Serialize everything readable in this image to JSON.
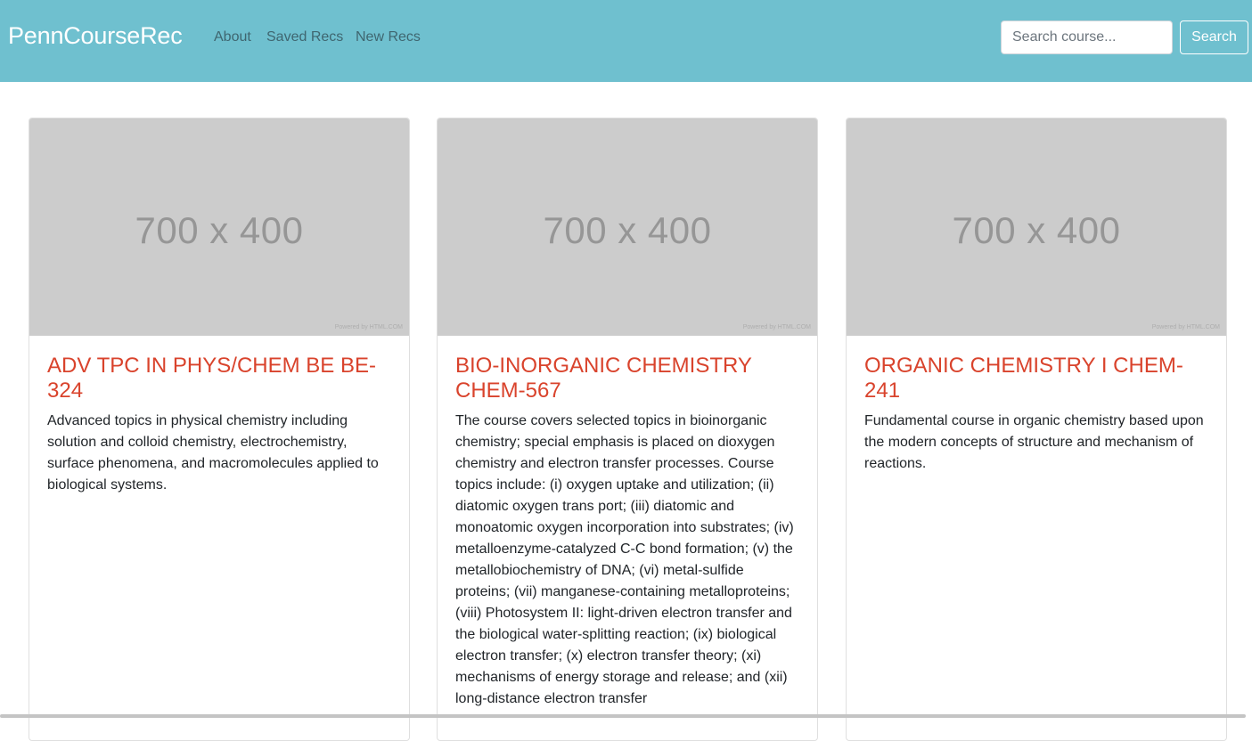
{
  "navbar": {
    "brand": "PennCourseRec",
    "links": [
      "About",
      "Saved Recs",
      "New Recs"
    ],
    "search_placeholder": "Search course...",
    "search_value": "",
    "search_button": "Search",
    "background_color": "#6fc0cf"
  },
  "cards": [
    {
      "image_text": "700 x 400",
      "image_credit": "Powered by HTML.COM",
      "title": "ADV TPC IN PHYS/CHEM BE BE-324",
      "description": "Advanced topics in physical chemistry including solution and colloid chemistry, electrochemistry, surface phenomena, and macromolecules applied to biological systems."
    },
    {
      "image_text": "700 x 400",
      "image_credit": "Powered by HTML.COM",
      "title": "BIO-INORGANIC CHEMISTRY CHEM-567",
      "description": "The course covers selected topics in bioinorganic chemistry; special emphasis is placed on dioxygen chemistry and electron transfer processes. Course topics include: (i) oxygen uptake and utilization; (ii) diatomic oxygen trans port; (iii) diatomic and monoatomic oxygen incorporation into substrates; (iv) metalloenzyme-catalyzed C-C bond formation; (v) the metallobiochemistry of DNA; (vi) metal-sulfide proteins; (vii) manganese-containing metalloproteins; (viii) Photosystem II: light-driven electron transfer and the biological water-splitting reaction; (ix) biological electron transfer; (x) electron transfer theory; (xi) mechanisms of energy storage and release; and (xii) long-distance electron transfer"
    },
    {
      "image_text": "700 x 400",
      "image_credit": "Powered by HTML.COM",
      "title": "ORGANIC CHEMISTRY I CHEM-241",
      "description": "Fundamental course in organic chemistry based upon the modern concepts of structure and mechanism of reactions."
    }
  ],
  "colors": {
    "title_accent": "#d9432c",
    "image_placeholder": "#cccccc"
  }
}
